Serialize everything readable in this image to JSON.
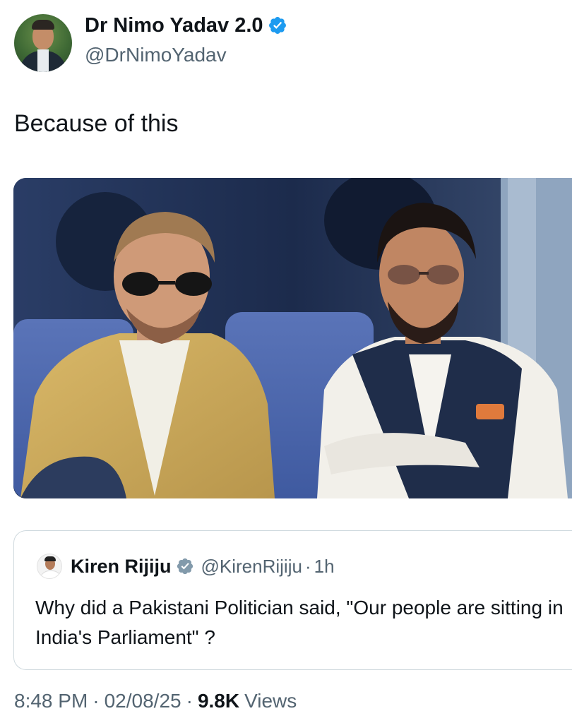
{
  "author": {
    "display_name": "Dr Nimo Yadav 2.0",
    "handle": "@DrNimoYadav",
    "verified": true,
    "avatar_icon": "profile-photo"
  },
  "tweet": {
    "text": "Because of this",
    "media_description_icon": "photo"
  },
  "quoted": {
    "display_name": "Kiren Rijiju",
    "handle": "@KirenRijiju",
    "separator": "·",
    "time": "1h",
    "verified": true,
    "text": "Why did a Pakistani Politician said, \"Our people are sitting in India's Parliament\" ?"
  },
  "meta": {
    "time": "8:48 PM",
    "separator": "·",
    "date": "02/08/25",
    "separator2": "·",
    "views_count": "9.8K",
    "views_label": "Views"
  },
  "colors": {
    "verified_badge": "#1d9bf0",
    "text_primary": "#0f1419",
    "text_secondary": "#536471",
    "border": "#cfd9de"
  }
}
